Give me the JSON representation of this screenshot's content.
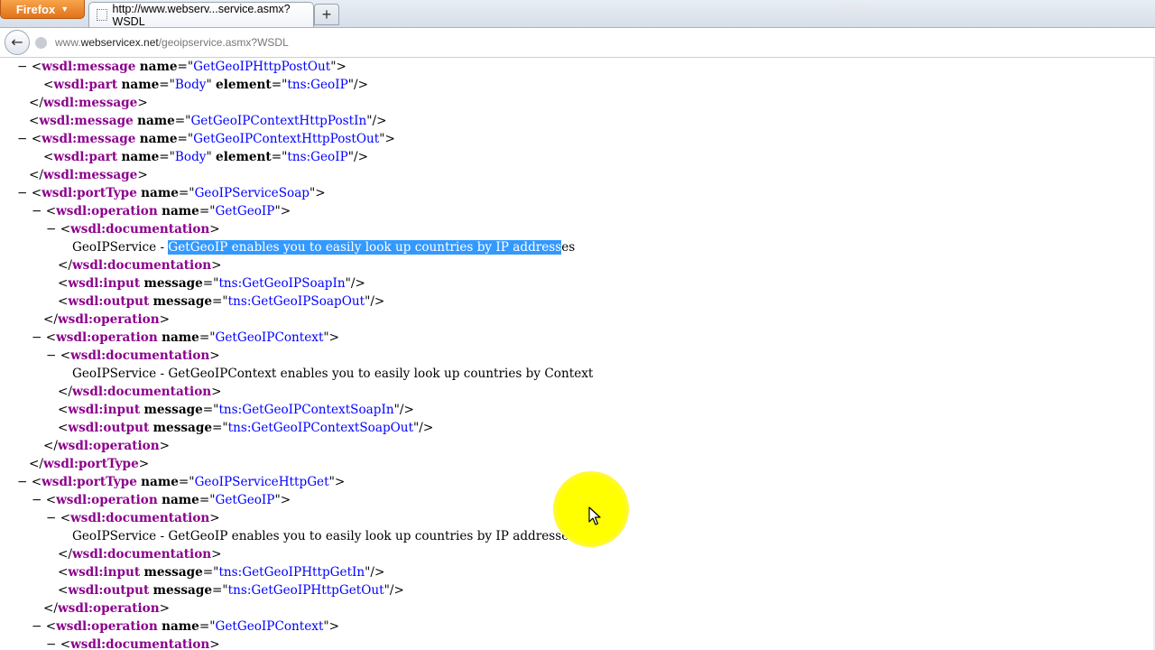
{
  "browser": {
    "app_button": "Firefox",
    "tab_title": "http://www.webserv...service.asmx?WSDL",
    "new_tab": "+",
    "back": "←",
    "url_prefix": "www.",
    "url_domain": "webservicex.net",
    "url_path": "/geoipservice.asmx?WSDL"
  },
  "doc": {
    "tags": {
      "message_open": "wsdl:message",
      "part": "wsdl:part",
      "portType": "wsdl:portType",
      "operation": "wsdl:operation",
      "documentation": "wsdl:documentation",
      "input": "wsdl:input",
      "output": "wsdl:output"
    },
    "attrs": {
      "name": "name",
      "element": "element",
      "message": "message"
    },
    "values": {
      "GetGeoIPHttpPostOut": "GetGeoIPHttpPostOut",
      "Body": "Body",
      "tnsGeoIP": "tns:GeoIP",
      "GetGeoIPContextHttpPostIn": "GetGeoIPContextHttpPostIn",
      "GetGeoIPContextHttpPostOut": "GetGeoIPContextHttpPostOut",
      "GeoIPServiceSoap": "GeoIPServiceSoap",
      "GetGeoIP": "GetGeoIP",
      "GetGeoIPContext": "GetGeoIPContext",
      "tnsGetGeoIPSoapIn": "tns:GetGeoIPSoapIn",
      "tnsGetGeoIPSoapOut": "tns:GetGeoIPSoapOut",
      "tnsGetGeoIPContextSoapIn": "tns:GetGeoIPContextSoapIn",
      "tnsGetGeoIPContextSoapOut": "tns:GetGeoIPContextSoapOut",
      "GeoIPServiceHttpGet": "GeoIPServiceHttpGet",
      "tnsGetGeoIPHttpGetIn": "tns:GetGeoIPHttpGetIn",
      "tnsGetGeoIPHttpGetOut": "tns:GetGeoIPHttpGetOut"
    },
    "text": {
      "doc1_prefix": "GeoIPService - ",
      "doc1_selected": "GetGeoIP enables you to easily look up countries by IP address",
      "doc1_suffix": "es",
      "doc2": "GeoIPService - GetGeoIPContext enables you to easily look up countries by Context",
      "doc3": "GeoIPService - GetGeoIP enables you to easily look up countries by IP addresses"
    },
    "collapse_symbol": "−"
  }
}
